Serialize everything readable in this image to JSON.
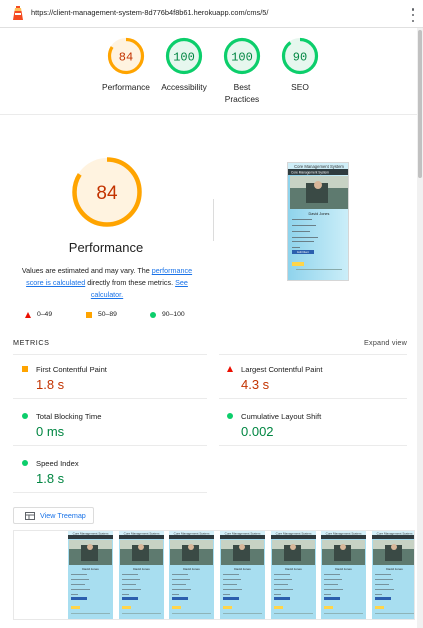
{
  "browser": {
    "url": "https://client-management-system-8d776b4f8b61.herokuapp.com/cms/5/"
  },
  "gauges": [
    {
      "label": "Performance",
      "score": "84",
      "level": "average"
    },
    {
      "label": "Accessibility",
      "score": "100",
      "level": "pass"
    },
    {
      "label": "Best Practices",
      "score": "100",
      "level": "pass"
    },
    {
      "label": "SEO",
      "score": "90",
      "level": "pass"
    }
  ],
  "performance": {
    "score": "84",
    "score_fraction": 0.84,
    "title": "Performance",
    "desc_part1": "Values are estimated and may vary. The ",
    "link_score": "performance score is calculated",
    "desc_part2": " directly from these metrics. ",
    "link_calc": "See calculator."
  },
  "legend": {
    "fail": "0–49",
    "average": "50–89",
    "pass": "90–100"
  },
  "metrics": {
    "header": "METRICS",
    "expand_label": "Expand view",
    "items": [
      {
        "label": "First Contentful Paint",
        "value": "1.8 s",
        "status": "average"
      },
      {
        "label": "Largest Contentful Paint",
        "value": "4.3 s",
        "status": "fail"
      },
      {
        "label": "Total Blocking Time",
        "value": "0 ms",
        "status": "pass"
      },
      {
        "label": "Cumulative Layout Shift",
        "value": "0.002",
        "status": "pass"
      },
      {
        "label": "Speed Index",
        "value": "1.8 s",
        "status": "pass"
      }
    ]
  },
  "treemap_button": "View Treemap",
  "screenshot": {
    "app_title": "Core Management System",
    "nav_title": "Core Management System",
    "person_name": "David Jones",
    "button_label": "Edit Client"
  },
  "colors": {
    "fail": "#eb0f00",
    "average": "#ffa400",
    "pass": "#0cce6b",
    "link": "#1a73e8"
  }
}
